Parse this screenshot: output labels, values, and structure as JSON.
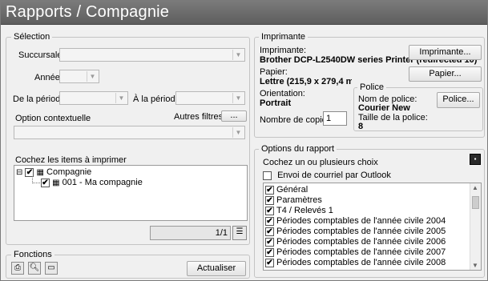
{
  "window": {
    "title": "Rapports / Compagnie"
  },
  "selection": {
    "legend": "Sélection",
    "succursale_label": "Succursale",
    "annee_label": "Année",
    "de_periode_label": "De la période",
    "a_periode_label": "À la période",
    "option_contextuelle_label": "Option contextuelle",
    "autres_filtres_label": "Autres filtres",
    "autres_filtres_button": "...",
    "items_label": "Cochez les items à imprimer",
    "tree": [
      {
        "label": "Compagnie",
        "checked": true
      },
      {
        "label": "001 - Ma compagnie",
        "checked": true
      }
    ],
    "tree_expander": "⊟",
    "pager": "1/1"
  },
  "fonctions": {
    "legend": "Fonctions",
    "actualiser": "Actualiser"
  },
  "imprimante": {
    "legend": "Imprimante",
    "imprimante_label": "Imprimante:",
    "imprimante_value": "Brother DCP-L2540DW series Printer (redirected 10)",
    "imprimante_button": "Imprimante...",
    "papier_label": "Papier:",
    "papier_value": "Lettre (215,9 x 279,4 mm)",
    "papier_button": "Papier...",
    "orientation_label": "Orientation:",
    "orientation_value": "Portrait",
    "copies_label": "Nombre de copies:",
    "copies_value": "1",
    "police": {
      "legend": "Police",
      "nom_label": "Nom de police:",
      "nom_value": "Courier New",
      "taille_label": "Taille de la police:",
      "taille_value": "8",
      "button": "Police..."
    }
  },
  "options": {
    "legend": "Options du rapport",
    "hint": "Cochez un ou plusieurs choix",
    "courriel_label": "Envoi de courriel par Outlook",
    "courriel_checked": false,
    "items": [
      {
        "label": "Général",
        "checked": true
      },
      {
        "label": "Paramètres",
        "checked": true
      },
      {
        "label": "T4 / Relevés 1",
        "checked": true
      },
      {
        "label": "Périodes comptables de l'année civile 2004",
        "checked": true
      },
      {
        "label": "Périodes comptables de l'année civile 2005",
        "checked": true
      },
      {
        "label": "Périodes comptables de l'année civile 2006",
        "checked": true
      },
      {
        "label": "Périodes comptables de l'année civile 2007",
        "checked": true
      },
      {
        "label": "Périodes comptables de l'année civile 2008",
        "checked": true
      }
    ]
  },
  "icons": [
    "printer-icon",
    "preview-icon",
    "export-icon",
    "save-icon",
    "filter-list-icon"
  ]
}
